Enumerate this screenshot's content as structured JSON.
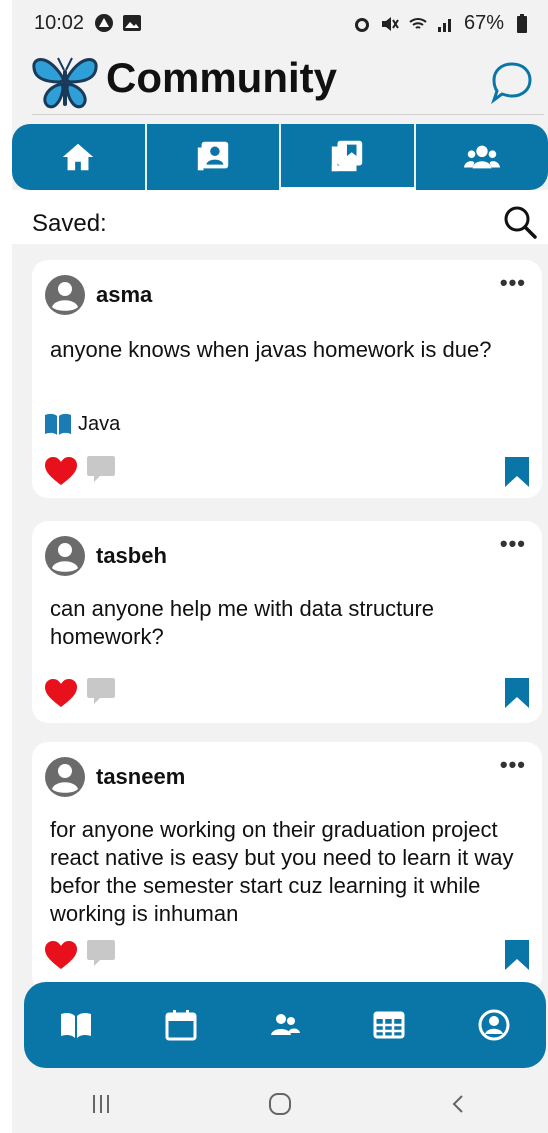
{
  "status_bar": {
    "time": "10:02",
    "battery": "67%"
  },
  "header": {
    "title": "Community"
  },
  "saved": {
    "label": "Saved:"
  },
  "posts": [
    {
      "author": "asma",
      "text": "anyone knows when javas homework is due?",
      "tag": "Java",
      "liked": true,
      "saved": true
    },
    {
      "author": "tasbeh",
      "text": "can anyone help me with data structure homework?",
      "liked": true,
      "saved": true
    },
    {
      "author": "tasneem",
      "text": "for anyone working on their graduation project react native is easy but you need to learn it way befor the semester start cuz learning it while working is inhuman",
      "liked": true,
      "saved": true
    }
  ],
  "colors": {
    "primary": "#0a76a8",
    "heart": "#e8101a",
    "comment": "#c8c8c8",
    "background": "#f2f2f2"
  },
  "icons": {
    "top_tabs": [
      "home-icon",
      "contact-card-icon",
      "saved-posts-icon",
      "groups-icon"
    ],
    "bottom_nav": [
      "book-icon",
      "calendar-icon",
      "users-icon",
      "table-icon",
      "profile-icon"
    ],
    "system_nav": [
      "recent-apps-icon",
      "home-circle-icon",
      "back-icon"
    ]
  }
}
